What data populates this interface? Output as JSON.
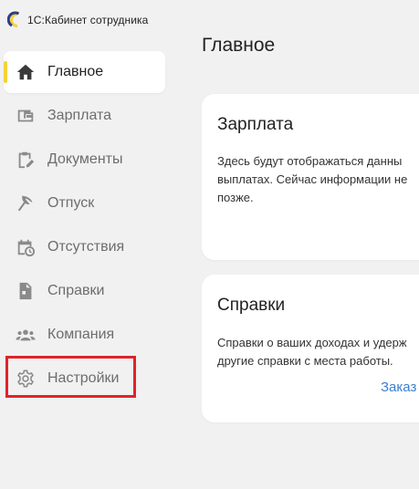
{
  "app": {
    "title": "1С:Кабинет сотрудника"
  },
  "sidebar": {
    "items": [
      {
        "label": "Главное",
        "icon": "home-icon",
        "active": true
      },
      {
        "label": "Зарплата",
        "icon": "wallet-icon",
        "active": false
      },
      {
        "label": "Документы",
        "icon": "document-edit-icon",
        "active": false
      },
      {
        "label": "Отпуск",
        "icon": "umbrella-icon",
        "active": false
      },
      {
        "label": "Отсутствия",
        "icon": "calendar-clock-icon",
        "active": false
      },
      {
        "label": "Справки",
        "icon": "file-icon",
        "active": false
      },
      {
        "label": "Компания",
        "icon": "people-icon",
        "active": false
      },
      {
        "label": "Настройки",
        "icon": "gear-icon",
        "active": false
      }
    ]
  },
  "main": {
    "title": "Главное",
    "cards": [
      {
        "title": "Зарплата",
        "lines": [
          "Здесь будут отображаться данны",
          "выплатах. Сейчас информации не",
          "позже."
        ]
      },
      {
        "title": "Справки",
        "lines": [
          "Справки о ваших доходах и удерж",
          "другие справки с места работы."
        ],
        "link": "Заказ"
      }
    ]
  },
  "colors": {
    "accent": "#f3d23c",
    "link": "#3b7fd0",
    "highlight": "#e0232a"
  }
}
